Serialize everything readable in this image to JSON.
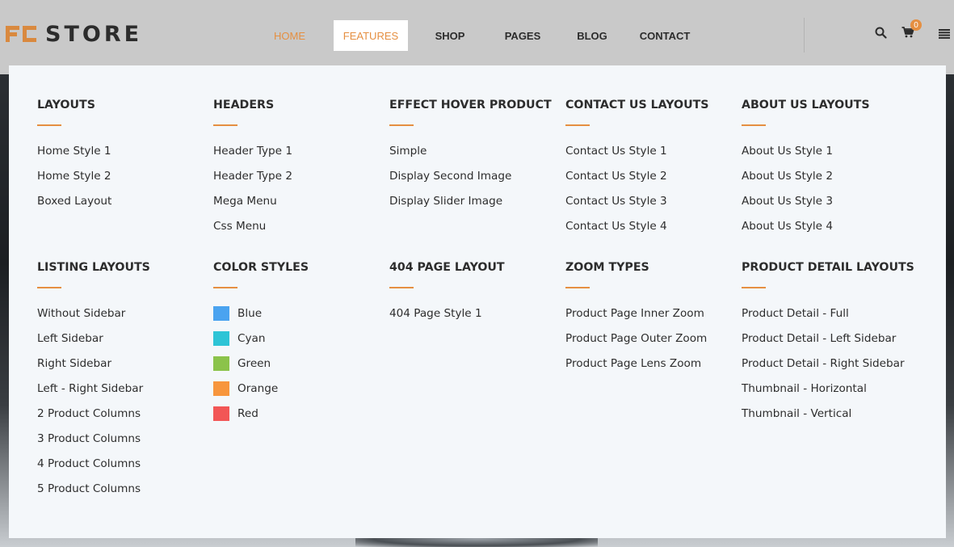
{
  "brand": {
    "logo_text": "STORE",
    "accent_color": "#e58f41"
  },
  "nav": {
    "items": [
      {
        "label": "HOME",
        "state": "active"
      },
      {
        "label": "FEATURES",
        "state": "open"
      },
      {
        "label": "SHOP",
        "state": "default"
      },
      {
        "label": "PAGES",
        "state": "default"
      },
      {
        "label": "BLOG",
        "state": "default"
      },
      {
        "label": "CONTACT",
        "state": "default"
      }
    ]
  },
  "header_icons": {
    "search": "search-icon",
    "cart": "cart-icon",
    "cart_count": "0",
    "menu": "hamburger-menu-icon"
  },
  "mega_menu": {
    "row1": [
      {
        "title": "LAYOUTS",
        "links": [
          "Home Style 1",
          "Home Style 2",
          "Boxed Layout"
        ]
      },
      {
        "title": "HEADERS",
        "links": [
          "Header Type 1",
          "Header Type 2",
          "Mega Menu",
          "Css Menu"
        ]
      },
      {
        "title": "EFFECT HOVER PRODUCT",
        "links": [
          "Simple",
          "Display Second Image",
          "Display Slider Image"
        ]
      },
      {
        "title": "CONTACT US LAYOUTS",
        "links": [
          "Contact Us Style 1",
          "Contact Us Style 2",
          "Contact Us Style 3",
          "Contact Us Style 4"
        ]
      },
      {
        "title": "ABOUT US LAYOUTS",
        "links": [
          "About Us Style 1",
          "About Us Style 2",
          "About Us Style 3",
          "About Us Style 4"
        ]
      }
    ],
    "row2": [
      {
        "title": "LISTING LAYOUTS",
        "links": [
          "Without Sidebar",
          "Left Sidebar",
          "Right Sidebar",
          "Left - Right Sidebar",
          "2 Product Columns",
          "3 Product Columns",
          "4 Product Columns",
          "5 Product Columns"
        ]
      },
      {
        "title": "COLOR STYLES",
        "links": [
          "Blue",
          "Cyan",
          "Green",
          "Orange",
          "Red"
        ],
        "swatches": [
          "#4aa3f0",
          "#2ec4d6",
          "#8bc34a",
          "#f7963d",
          "#f25656"
        ]
      },
      {
        "title": "404 PAGE LAYOUT",
        "links": [
          "404 Page Style 1"
        ]
      },
      {
        "title": "ZOOM TYPES",
        "links": [
          "Product Page Inner Zoom",
          "Product Page Outer Zoom",
          "Product Page Lens Zoom"
        ]
      },
      {
        "title": "PRODUCT DETAIL LAYOUTS",
        "links": [
          "Product Detail - Full",
          "Product Detail - Left Sidebar",
          "Product Detail - Right Sidebar",
          "Thumbnail - Horizontal",
          "Thumbnail - Vertical"
        ]
      }
    ]
  }
}
